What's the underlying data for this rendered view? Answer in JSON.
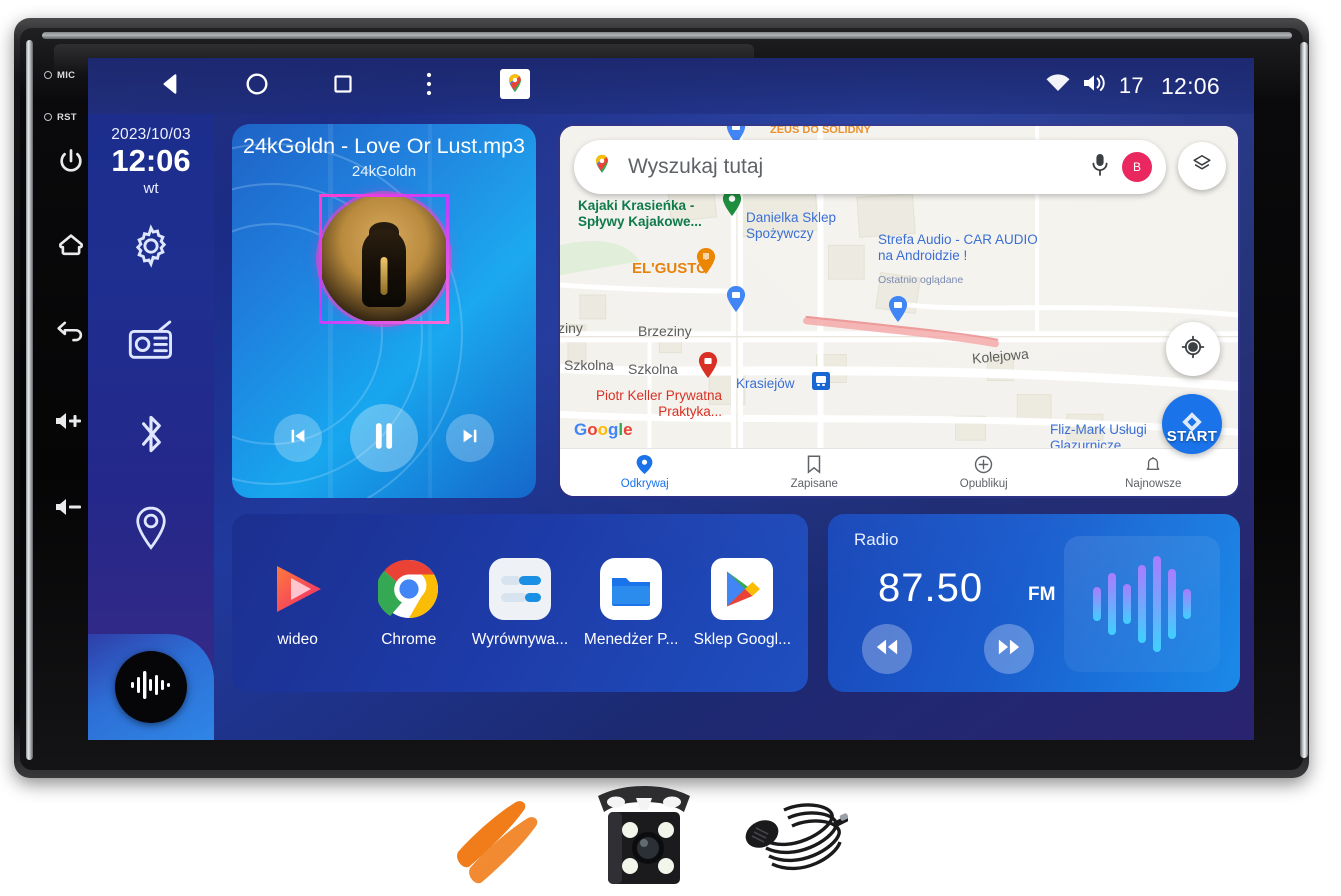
{
  "device": {
    "side_buttons": [
      {
        "name": "mic-indicator",
        "label": "MIC"
      },
      {
        "name": "reset-indicator",
        "label": "RST"
      },
      {
        "name": "power-button",
        "label": "power-icon"
      },
      {
        "name": "home-button",
        "label": "home-icon"
      },
      {
        "name": "back-button",
        "label": "back-icon"
      },
      {
        "name": "volume-up-button",
        "label": "volume-up-icon"
      },
      {
        "name": "volume-down-button",
        "label": "volume-down-icon"
      }
    ]
  },
  "statusbar": {
    "nav": [
      {
        "name": "nav-back",
        "icon": "triangle-left-icon"
      },
      {
        "name": "nav-home",
        "icon": "circle-icon"
      },
      {
        "name": "nav-recents",
        "icon": "square-icon"
      },
      {
        "name": "nav-more",
        "icon": "overflow-menu-icon"
      },
      {
        "name": "nav-maps-shortcut",
        "icon": "google-maps-icon"
      }
    ],
    "wifi_icon": "wifi-icon",
    "volume_icon": "speaker-icon",
    "volume_level": "17",
    "clock": "12:06"
  },
  "sidebar": {
    "date": "2023/10/03",
    "time": "12:06",
    "weekday": "wt",
    "items": [
      {
        "name": "settings",
        "icon": "gear-icon"
      },
      {
        "name": "radio",
        "icon": "radio-icon"
      },
      {
        "name": "bluetooth",
        "icon": "bluetooth-icon"
      },
      {
        "name": "navigation",
        "icon": "location-pin-icon"
      }
    ],
    "badge_icon": "audio-waveform-icon"
  },
  "music": {
    "title": "24kGoldn - Love Or Lust.mp3",
    "artist": "24kGoldn",
    "controls": [
      {
        "name": "previous-track-button",
        "icon": "skip-previous-icon"
      },
      {
        "name": "play-pause-button",
        "icon": "pause-icon"
      },
      {
        "name": "next-track-button",
        "icon": "skip-next-icon"
      }
    ]
  },
  "map": {
    "search_placeholder": "Wyszukaj tutaj",
    "mic_icon": "microphone-icon",
    "avatar_initial": "B",
    "layers_icon": "layers-icon",
    "locate_icon": "my-location-icon",
    "start_label": "START",
    "google_logo": "Google",
    "clipped_top_label": "ZEUS DO SOLIDNY",
    "labels": [
      {
        "text": "Kajaki Krasieńka - Spływy Kajakowe...",
        "type": "poi-green"
      },
      {
        "text": "Danielka Sklep Spożywczy",
        "type": "poi-blue"
      },
      {
        "text": "Strefa Audio - CAR AUDIO na Androidzie !",
        "type": "poi-blue"
      },
      {
        "text": "Ostatnio oglądane",
        "type": "sub"
      },
      {
        "text": "EL'GUSTO",
        "type": "poi-orange"
      },
      {
        "text": "Brzeziny",
        "type": "street"
      },
      {
        "text": "ziny",
        "type": "street"
      },
      {
        "text": "Szkolna",
        "type": "street"
      },
      {
        "text": "Szkolna",
        "type": "street"
      },
      {
        "text": "Kolejowa",
        "type": "street"
      },
      {
        "text": "Piotr Keller Prywatna Praktyka...",
        "type": "poi-red"
      },
      {
        "text": "Krasiejów",
        "type": "poi-blue"
      },
      {
        "text": "Fliz-Mark Usługi Glazurnicze",
        "type": "poi-blue"
      }
    ],
    "bottom_nav": [
      {
        "label": "Odkrywaj",
        "icon": "location-pin-icon",
        "active": true
      },
      {
        "label": "Zapisane",
        "icon": "bookmark-icon",
        "active": false
      },
      {
        "label": "Opublikuj",
        "icon": "plus-circle-icon",
        "active": false
      },
      {
        "label": "Najnowsze",
        "icon": "bell-icon",
        "active": false
      }
    ]
  },
  "apps": [
    {
      "label": "wideo",
      "icon": "video-player-icon"
    },
    {
      "label": "Chrome",
      "icon": "chrome-icon"
    },
    {
      "label": "Wyrównywa...",
      "icon": "equalizer-icon"
    },
    {
      "label": "Menedżer P...",
      "icon": "file-manager-icon"
    },
    {
      "label": "Sklep Googl...",
      "icon": "google-play-icon"
    }
  ],
  "radio": {
    "title": "Radio",
    "frequency": "87.50",
    "band": "FM",
    "controls": [
      {
        "name": "seek-down-button",
        "icon": "rewind-icon"
      },
      {
        "name": "seek-up-button",
        "icon": "fast-forward-icon"
      }
    ],
    "visualizer_bars": [
      34,
      62,
      40,
      78,
      96,
      70,
      30
    ]
  },
  "accessories": [
    {
      "name": "pry-tools",
      "label": "trim-removal-tools"
    },
    {
      "name": "backup-camera",
      "label": "rear-view-camera"
    },
    {
      "name": "microphone",
      "label": "external-microphone"
    }
  ],
  "colors": {
    "screen_blue": "#1e2f90",
    "accent_blue": "#1a73e8",
    "music_blue": "#17a7ef",
    "map_bg": "#f3f1ec"
  }
}
